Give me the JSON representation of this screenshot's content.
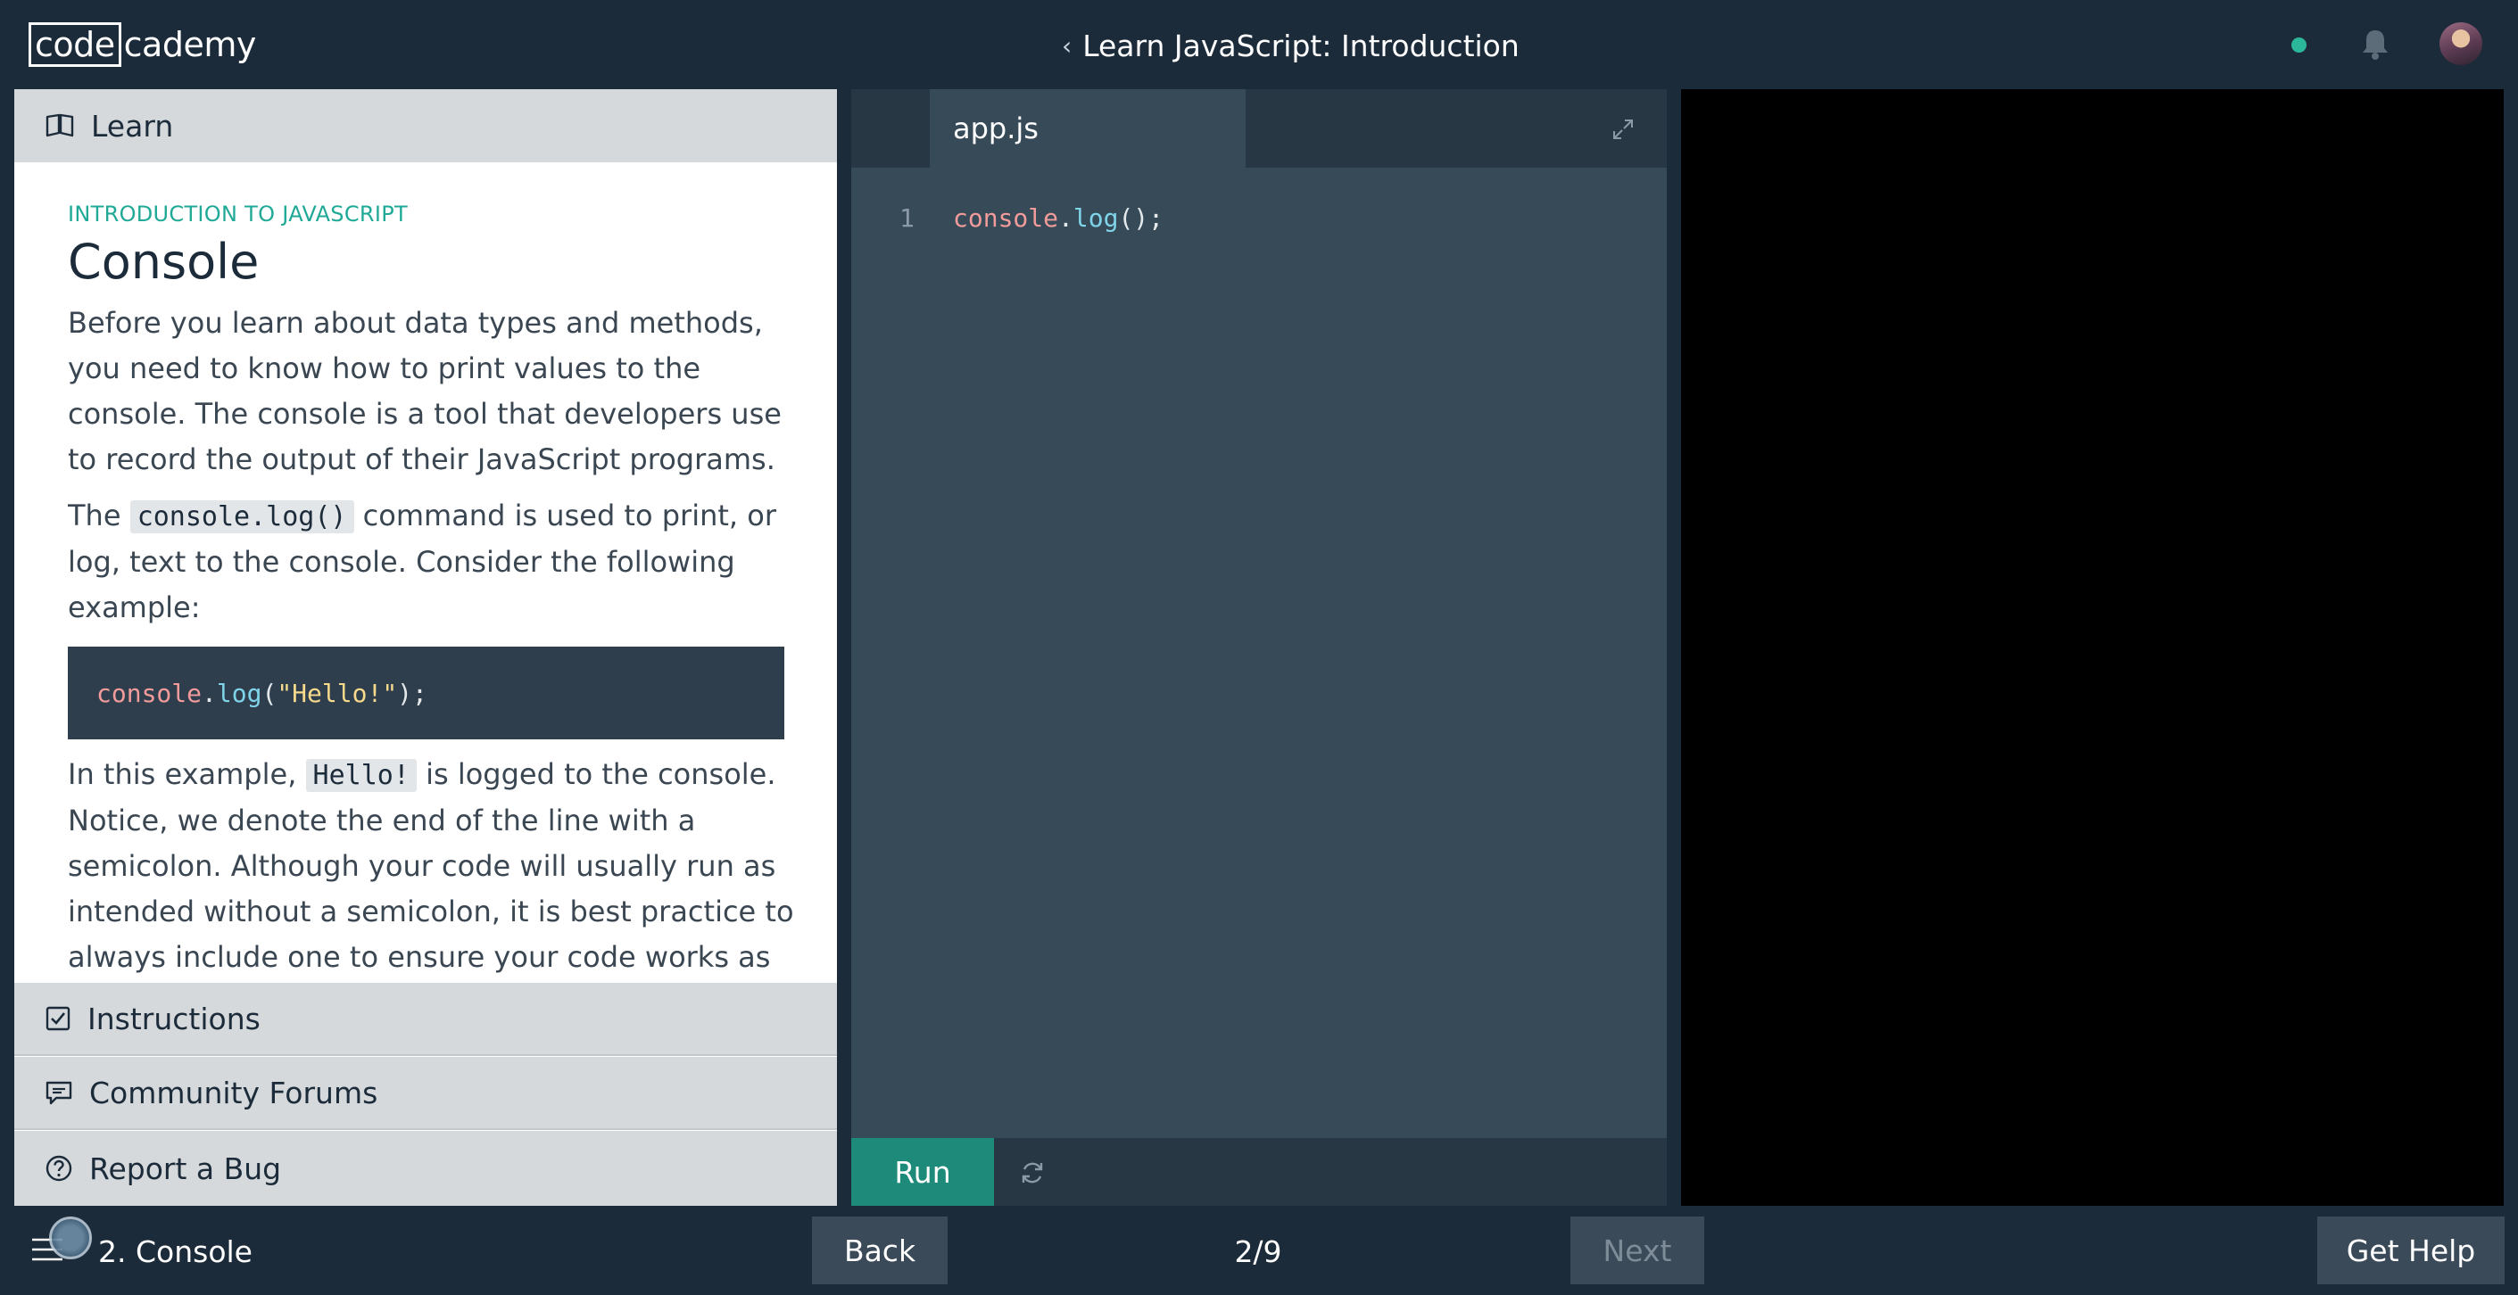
{
  "header": {
    "logo_left": "code",
    "logo_right": "cademy",
    "course_title": "Learn JavaScript: Introduction",
    "back_chevron": "‹"
  },
  "left_panel": {
    "learn_tab": "Learn",
    "eyebrow": "INTRODUCTION TO JAVASCRIPT",
    "title": "Console",
    "p1": "Before you learn about data types and methods, you need to know how to print values to the console. The console is a tool that developers use to record the output of their JavaScript programs.",
    "p2_before": "The ",
    "p2_code": "console.log()",
    "p2_after": " command is used to print, or log, text to the console. Consider the following example:",
    "example": {
      "obj": "console",
      "dot": ".",
      "fn": "log",
      "open": "(",
      "str": "\"Hello!\"",
      "close": ");"
    },
    "p3_before": "In this example, ",
    "p3_code": "Hello!",
    "p3_after": " is logged to the console. Notice, we denote the end of the line with a semicolon. Although your code will usually run as intended without a semicolon, it is best practice to always include one to ensure your code works as expected in situations when it",
    "instructions_tab": "Instructions",
    "forums_tab": "Community Forums",
    "bug_tab": "Report a Bug"
  },
  "editor": {
    "file_name": "app.js",
    "line_number": "1",
    "code": {
      "obj": "console",
      "dot": ".",
      "fn": "log",
      "rest": "();"
    },
    "run_label": "Run"
  },
  "footer": {
    "lesson_name": "2. Console",
    "back_label": "Back",
    "progress": "2/9",
    "next_label": "Next",
    "help_label": "Get Help"
  },
  "colors": {
    "accent": "#1e8a7a",
    "eyebrow": "#1fa996",
    "status_dot": "#2bb89a",
    "page_bg": "#1c2b3a",
    "editor_bg": "#364a58"
  },
  "icons": [
    "bell-icon",
    "book-icon",
    "checkbox-icon",
    "chat-icon",
    "question-icon",
    "expand-icon",
    "reset-icon",
    "menu-icon"
  ]
}
